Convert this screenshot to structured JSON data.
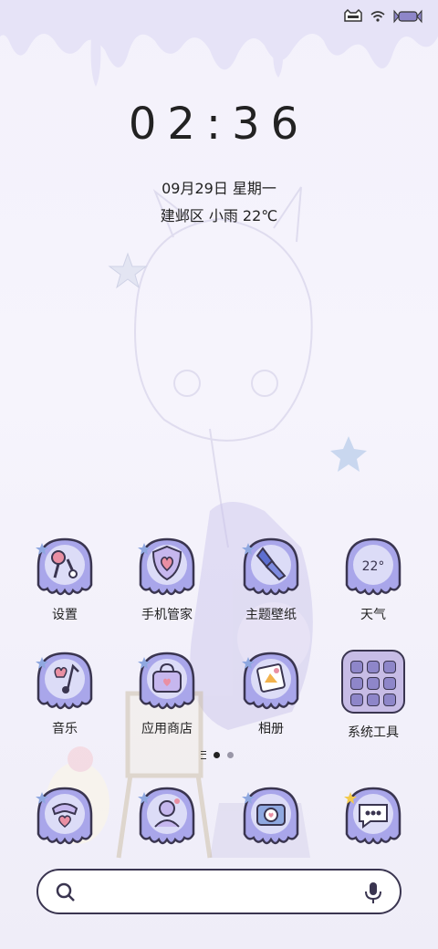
{
  "status_bar": {
    "icons": [
      "cat-face-icon",
      "wifi-icon",
      "battery-candy-icon"
    ]
  },
  "lockscreen": {
    "time": "02:36",
    "date": "09月29日 星期一",
    "weather": "建邺区 小雨 22℃"
  },
  "apps": {
    "row1": [
      {
        "label": "设置",
        "icon": "settings-icon"
      },
      {
        "label": "手机管家",
        "icon": "phone-manager-icon"
      },
      {
        "label": "主题壁纸",
        "icon": "theme-wallpaper-icon"
      },
      {
        "label": "天气",
        "icon": "weather-icon",
        "icon_text": "22°"
      }
    ],
    "row2": [
      {
        "label": "音乐",
        "icon": "music-icon"
      },
      {
        "label": "应用商店",
        "icon": "app-store-icon"
      },
      {
        "label": "相册",
        "icon": "gallery-icon"
      },
      {
        "label": "系统工具",
        "icon": "system-tools-folder-icon"
      }
    ],
    "dock": [
      {
        "icon": "phone-icon"
      },
      {
        "icon": "contacts-icon"
      },
      {
        "icon": "camera-icon"
      },
      {
        "icon": "messages-icon"
      }
    ]
  },
  "pager": {
    "pages": 2,
    "current": 1
  },
  "search": {
    "search_icon": "search-icon",
    "mic_icon": "microphone-icon"
  },
  "colors": {
    "accent": "#8e86c9",
    "icon_fill": "#a9a6ea",
    "outline": "#3a3550",
    "background": "#f3f1fb"
  }
}
